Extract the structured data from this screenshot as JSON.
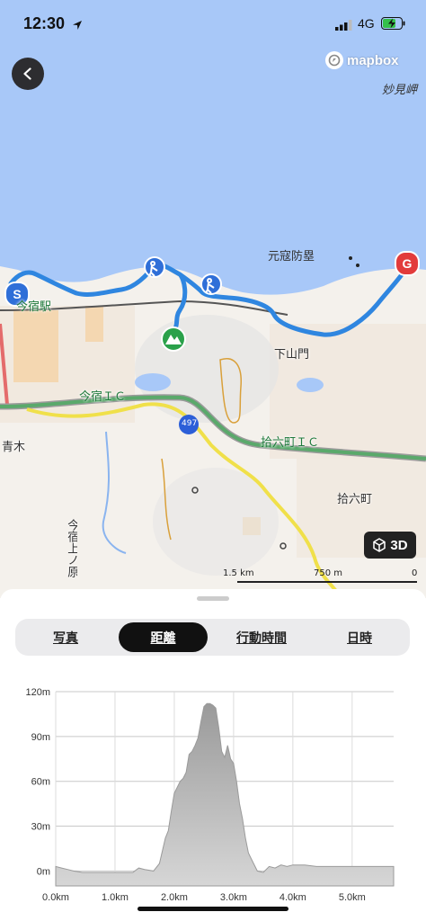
{
  "status_bar": {
    "time": "12:30",
    "network": "4G"
  },
  "map": {
    "attribution": "mapbox",
    "labels": {
      "cape": "妙見岬",
      "wall": "元寇防塁",
      "station": "今宿駅",
      "district_shimoyamato": "下山門",
      "ic_imajuku": "今宿ＩＣ",
      "ic_jurokucho": "拾六町ＩＣ",
      "district_jurokucho": "拾六町",
      "district_aoki": "青木",
      "district_kamino": "今宿上ノ原",
      "route_number": "497"
    },
    "markers": {
      "start": "S",
      "goal": "G"
    },
    "button_3d": "3D",
    "scale": {
      "left": "1.5 km",
      "mid": "750 m",
      "right": "0"
    }
  },
  "tabs": [
    {
      "label": "写真",
      "active": false
    },
    {
      "label": "距離",
      "active": true
    },
    {
      "label": "行動時間",
      "active": false
    },
    {
      "label": "日時",
      "active": false
    }
  ],
  "chart_data": {
    "type": "area",
    "xlabel": "",
    "ylabel": "",
    "x_ticks": [
      "0.0km",
      "1.0km",
      "2.0km",
      "3.0km",
      "4.0km",
      "5.0km"
    ],
    "y_ticks": [
      "0m",
      "30m",
      "60m",
      "90m",
      "120m"
    ],
    "xlim": [
      0,
      5.7
    ],
    "ylim": [
      -10,
      120
    ],
    "grid": true,
    "series": [
      {
        "x": [
          0.0,
          0.1,
          0.2,
          0.3,
          0.45,
          0.6,
          0.8,
          1.0,
          1.2,
          1.3,
          1.4,
          1.5,
          1.65,
          1.75,
          1.85,
          1.9,
          1.95,
          2.0,
          2.05,
          2.1,
          2.15,
          2.2,
          2.25,
          2.3,
          2.35,
          2.4,
          2.45,
          2.5,
          2.55,
          2.6,
          2.65,
          2.7,
          2.75,
          2.8,
          2.85,
          2.9,
          2.95,
          3.0,
          3.05,
          3.1,
          3.15,
          3.2,
          3.25,
          3.3,
          3.4,
          3.5,
          3.6,
          3.7,
          3.8,
          3.9,
          4.0,
          4.1,
          4.2,
          4.4,
          4.6,
          4.8,
          5.0,
          5.2,
          5.4,
          5.7
        ],
        "values": [
          3,
          2,
          1,
          0,
          -1,
          -1,
          -1,
          -1,
          -1,
          -1,
          2,
          1,
          0,
          5,
          22,
          27,
          40,
          52,
          56,
          60,
          62,
          66,
          78,
          80,
          84,
          89,
          100,
          110,
          112,
          112,
          111,
          109,
          96,
          80,
          76,
          84,
          75,
          72,
          60,
          45,
          35,
          22,
          12,
          8,
          0,
          -1,
          3,
          2,
          4,
          3,
          4,
          4,
          4,
          3,
          3,
          3,
          3,
          3,
          3,
          3
        ]
      }
    ]
  }
}
